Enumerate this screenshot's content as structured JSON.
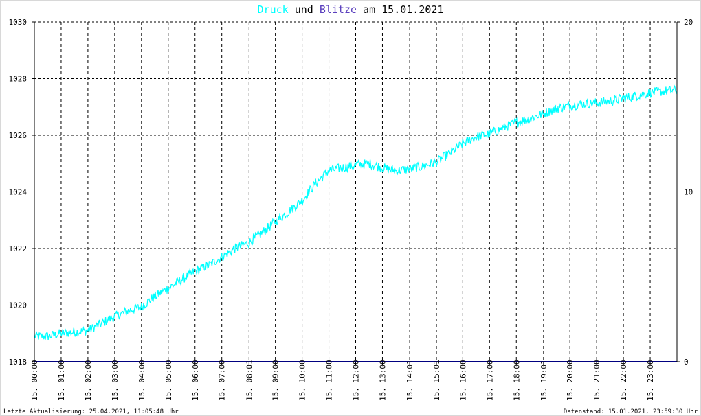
{
  "chart_data": {
    "type": "line",
    "title": {
      "part1": "Druck",
      "part2": " und ",
      "part3": "Blitze",
      "part4": " am 15.01.2021"
    },
    "colors": {
      "druck": "#00ffff",
      "blitze": "#5a3fbd",
      "grid": "#000000",
      "baseline": "#000080"
    },
    "left_axis": {
      "ylim": [
        1018,
        1030
      ],
      "ticks": [
        "1018",
        "1020",
        "1022",
        "1024",
        "1026",
        "1028",
        "1030"
      ]
    },
    "right_axis": {
      "ylim": [
        0,
        20
      ],
      "ticks": [
        "0",
        "10",
        "20"
      ]
    },
    "x_ticks": [
      "15. 00:00",
      "15. 01:00",
      "15. 02:00",
      "15. 03:00",
      "15. 04:00",
      "15. 05:00",
      "15. 06:00",
      "15. 07:00",
      "15. 08:01",
      "15. 09:00",
      "15. 10:00",
      "15. 11:00",
      "15. 12:00",
      "15. 13:00",
      "15. 14:01",
      "15. 15:01",
      "15. 16:00",
      "15. 17:00",
      "15. 18:00",
      "15. 19:01",
      "15. 20:00",
      "15. 21:00",
      "15. 22:00",
      "15. 23:00"
    ],
    "x_tick_hours": [
      0,
      1,
      2,
      3,
      4,
      5,
      6,
      7,
      8.017,
      9,
      10,
      11,
      12,
      13,
      14.017,
      15.017,
      16,
      17,
      18,
      19.017,
      20,
      21,
      22,
      23
    ],
    "grid": true,
    "series": [
      {
        "name": "Druck",
        "x_hours": [
          0,
          0.5,
          1,
          1.5,
          2,
          2.5,
          3,
          3.5,
          4,
          4.5,
          5,
          5.5,
          6,
          6.5,
          7,
          7.5,
          8,
          8.5,
          9,
          9.5,
          10,
          10.5,
          11,
          11.5,
          12,
          12.5,
          13,
          13.5,
          14,
          14.5,
          15,
          15.5,
          16,
          16.5,
          17,
          17.5,
          18,
          18.5,
          19,
          19.5,
          20,
          20.5,
          21,
          21.5,
          22,
          22.5,
          23,
          23.5,
          24
        ],
        "values": [
          1018.9,
          1018.9,
          1019.0,
          1019.05,
          1019.1,
          1019.35,
          1019.6,
          1019.8,
          1019.95,
          1020.3,
          1020.6,
          1020.9,
          1021.2,
          1021.4,
          1021.7,
          1022.0,
          1022.2,
          1022.55,
          1022.95,
          1023.3,
          1023.7,
          1024.3,
          1024.75,
          1024.85,
          1024.95,
          1025.0,
          1024.85,
          1024.75,
          1024.8,
          1024.9,
          1025.05,
          1025.35,
          1025.7,
          1025.95,
          1026.05,
          1026.25,
          1026.45,
          1026.6,
          1026.75,
          1026.95,
          1027.05,
          1027.1,
          1027.15,
          1027.2,
          1027.3,
          1027.4,
          1027.5,
          1027.55,
          1027.6
        ]
      },
      {
        "name": "Blitze",
        "x_hours": [
          0,
          24
        ],
        "values": [
          0,
          0
        ]
      }
    ]
  },
  "footer": {
    "left": "Letzte Aktualisierung: 25.04.2021, 11:05:48 Uhr",
    "right": "Datenstand: 15.01.2021, 23:59:30 Uhr"
  }
}
